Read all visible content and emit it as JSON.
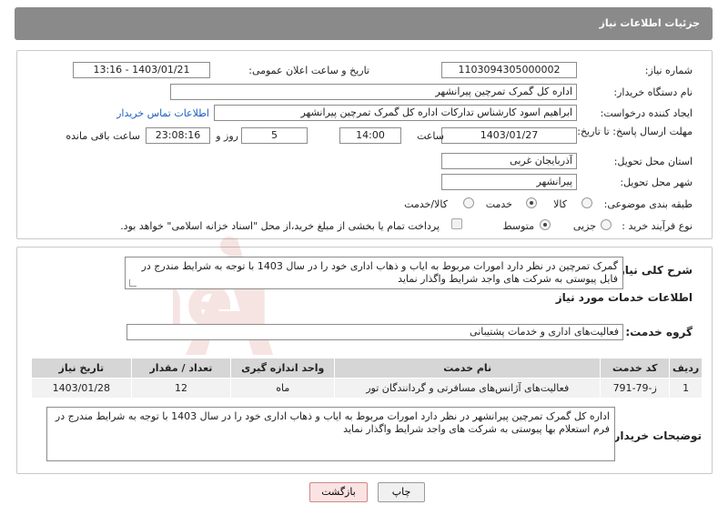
{
  "header": {
    "title": "جزئیات اطلاعات نیاز"
  },
  "form": {
    "need_number_label": "شماره نیاز:",
    "need_number": "1103094305000002",
    "announce_label": "تاریخ و ساعت اعلان عمومی:",
    "announce_value": "1403/01/21 - 13:16",
    "buyer_org_label": "نام دستگاه خریدار:",
    "buyer_org": "اداره کل گمرک تمرچین پیرانشهر",
    "creator_label": "ایجاد کننده درخواست:",
    "creator": "ابراهیم اسود کارشناس تدارکات اداره کل گمرک تمرچین پیرانشهر",
    "contact_link": "اطلاعات تماس خریدار",
    "deadline_label": "مهلت ارسال پاسخ: تا تاریخ:",
    "deadline_date": "1403/01/27",
    "time_label": "ساعت",
    "deadline_time": "14:00",
    "days_value": "5",
    "days_label": "روز و",
    "remaining_time": "23:08:16",
    "remaining_label": "ساعت باقی مانده",
    "province_label": "استان محل تحویل:",
    "province": "آذربایجان غربی",
    "city_label": "شهر محل تحویل:",
    "city": "پیرانشهر",
    "category_label": "طبقه بندی موضوعی:",
    "category_options": [
      "کالا",
      "خدمت",
      "کالا/خدمت"
    ],
    "category_selected": 1,
    "process_label": "نوع فرآیند خرید :",
    "process_options": [
      "جزیی",
      "متوسط"
    ],
    "process_selected": 1,
    "payment_note": "پرداخت تمام یا بخشی از مبلغ خرید،از محل \"اسناد خزانه اسلامی\" خواهد بود."
  },
  "summary": {
    "label": "شرح کلی نیاز:",
    "text": "گمرک تمرچین در نظر دارد امورات مربوط به ایاب و ذهاب اداری خود را در سال 1403 با توجه به شرایط مندرج در فایل پیوستی به شرکت های واجد شرایط واگذار نماید"
  },
  "services": {
    "section_title": "اطلاعات خدمات مورد نیاز",
    "group_label": "گروه خدمت:",
    "group_value": "فعالیت‌های اداری و خدمات پشتیبانی",
    "columns": [
      "ردیف",
      "کد خدمت",
      "نام خدمت",
      "واحد اندازه گیری",
      "تعداد / مقدار",
      "تاریخ نیاز"
    ],
    "rows": [
      [
        "1",
        "ز-79-791",
        "فعالیت‌های آژانس‌های مسافرتی و گردانندگان تور",
        "ماه",
        "12",
        "1403/01/28"
      ]
    ]
  },
  "buyer_notes": {
    "label": "توضیحات خریدار:",
    "text": "اداره کل گمرک تمرچین پیرانشهر در نظر دارد امورات مربوط به ایاب و ذهاب اداری خود را در سال 1403 با توجه به شرایط مندرج در فرم استعلام بها پیوستی به شرکت های واجد شرایط واگذار نماید"
  },
  "buttons": {
    "print": "چاپ",
    "back": "بازگشت"
  },
  "watermark": {
    "text": "AriaTender.neT"
  },
  "colors": {
    "header": "#8a8a8a",
    "link": "#1f5fbf",
    "table_header": "#d6d6d6",
    "watermark": "#c0392b"
  }
}
